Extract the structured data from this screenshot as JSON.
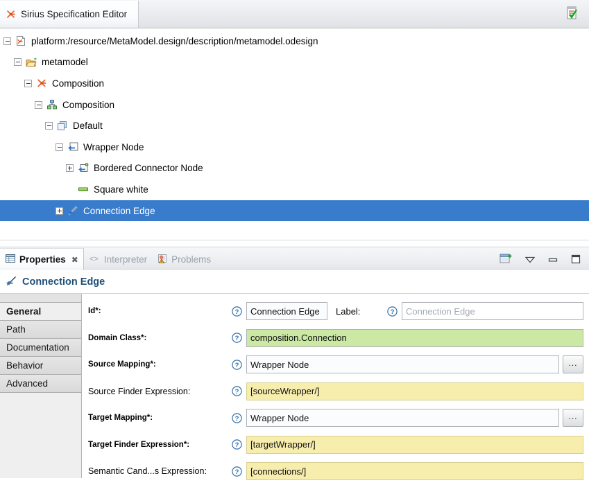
{
  "editor": {
    "tab_label": "Sirius Specification Editor",
    "tab_icon": "sirius-viewpoint-icon",
    "validate_icon": "validate-checklist-icon"
  },
  "tree": {
    "rows": [
      {
        "indent": 0,
        "twisty": "minus",
        "icon": "odesign-file-icon",
        "label": "platform:/resource/MetaModel.design/description/metamodel.odesign",
        "selected": false
      },
      {
        "indent": 1,
        "twisty": "minus",
        "icon": "open-folder-icon",
        "label": "metamodel",
        "selected": false
      },
      {
        "indent": 2,
        "twisty": "minus",
        "icon": "sirius-viewpoint-icon",
        "label": "Composition",
        "selected": false
      },
      {
        "indent": 3,
        "twisty": "minus",
        "icon": "diagram-description-icon",
        "label": "Composition",
        "selected": false
      },
      {
        "indent": 4,
        "twisty": "minus",
        "icon": "default-layer-icon",
        "label": "Default",
        "selected": false
      },
      {
        "indent": 5,
        "twisty": "minus",
        "icon": "node-mapping-icon",
        "label": "Wrapper Node",
        "selected": false
      },
      {
        "indent": 6,
        "twisty": "plus",
        "icon": "bordered-node-mapping-icon",
        "label": "Bordered Connector Node",
        "selected": false
      },
      {
        "indent": 6,
        "twisty": "none",
        "icon": "green-square-style-icon",
        "label": "Square white",
        "selected": false
      },
      {
        "indent": 5,
        "twisty": "plus",
        "icon": "edge-mapping-icon",
        "label": "Connection Edge",
        "selected": true
      }
    ]
  },
  "properties_view": {
    "tabs": [
      {
        "label": "Properties",
        "icon": "properties-table-icon",
        "active": true,
        "closable": true
      },
      {
        "label": "Interpreter",
        "icon": "interpreter-code-icon",
        "active": false,
        "closable": false
      },
      {
        "label": "Problems",
        "icon": "problems-warning-icon",
        "active": false,
        "closable": false
      }
    ],
    "toolbar": [
      {
        "name": "new-properties-view-icon"
      },
      {
        "name": "view-menu-chevron-icon"
      },
      {
        "name": "minimize-icon"
      },
      {
        "name": "maximize-icon"
      }
    ],
    "header": {
      "title": "Connection Edge",
      "icon": "edge-mapping-icon"
    },
    "section_tabs": [
      {
        "label": "General",
        "active": true
      },
      {
        "label": "Path",
        "active": false
      },
      {
        "label": "Documentation",
        "active": false
      },
      {
        "label": "Behavior",
        "active": false
      },
      {
        "label": "Advanced",
        "active": false
      }
    ],
    "fields": {
      "id": {
        "label": "Id*:",
        "required": true,
        "value": "Connection Edge",
        "help": "help-icon"
      },
      "label": {
        "label": "Label:",
        "required": false,
        "value": "",
        "placeholder": "Connection Edge",
        "help": "help-icon"
      },
      "domain_class": {
        "label": "Domain Class*:",
        "required": true,
        "value": "composition.Connection",
        "state": "green",
        "help": "help-icon"
      },
      "source_mapping": {
        "label": "Source Mapping*:",
        "required": true,
        "value": "Wrapper Node",
        "browse_label": "...",
        "help": "help-icon"
      },
      "source_finder_expression": {
        "label": "Source Finder Expression:",
        "required": false,
        "value": "[sourceWrapper/]",
        "state": "yellow",
        "help": "help-icon"
      },
      "target_mapping": {
        "label": "Target Mapping*:",
        "required": true,
        "value": "Wrapper Node",
        "browse_label": "...",
        "help": "help-icon"
      },
      "target_finder_expression": {
        "label": "Target Finder Expression*:",
        "required": true,
        "value": "[targetWrapper/]",
        "state": "yellow",
        "help": "help-icon"
      },
      "semantic_candidates_expression": {
        "label": "Semantic Cand...s Expression:",
        "required": false,
        "value": "[connections/]",
        "state": "yellow",
        "help": "help-icon"
      }
    }
  },
  "colors": {
    "selection_blue": "#3a7ccc",
    "ok_green": "#cbe8a4",
    "expression_yellow": "#f7edad",
    "header_title_blue": "#1f4e79",
    "sirius_orange": "#e8622a"
  }
}
